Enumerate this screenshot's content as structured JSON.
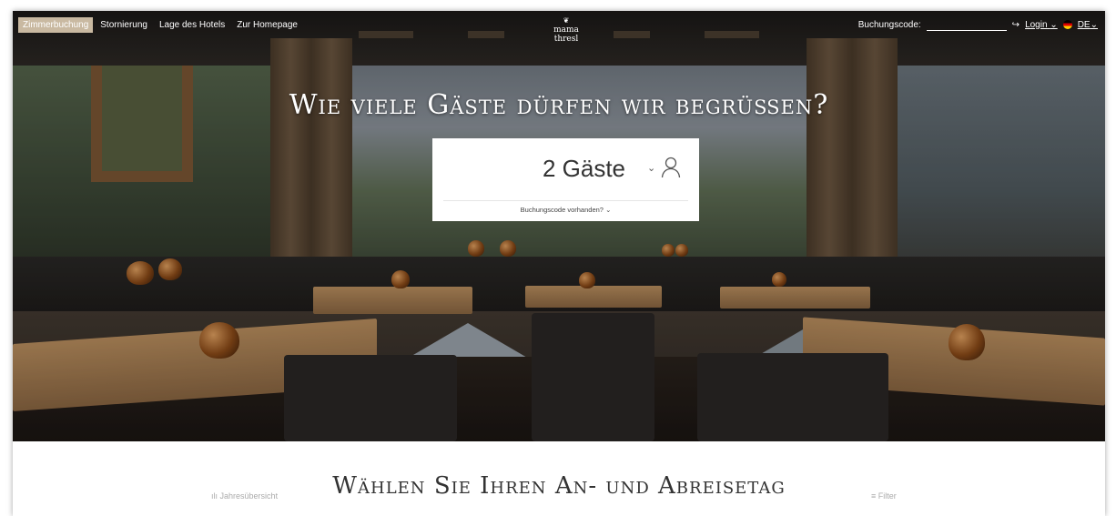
{
  "nav": {
    "links": [
      {
        "label": "Zimmerbuchung"
      },
      {
        "label": "Stornierung"
      },
      {
        "label": "Lage des Hotels"
      },
      {
        "label": "Zur Homepage"
      }
    ],
    "logo_line1": "mama",
    "logo_line2": "thresl",
    "booking_code_label": "Buchungscode:",
    "booking_code_value": "",
    "submit_icon": "↪",
    "login_label": "Login",
    "language_label": "DE"
  },
  "hero": {
    "title": "Wie viele Gäste dürfen wir begrüßen?"
  },
  "guest_selector": {
    "value": "2 Gäste",
    "chevron": "⌄",
    "booking_code_link": "Buchungscode vorhanden?"
  },
  "bottom": {
    "year_overview": "Jahresübersicht",
    "title": "Wählen Sie Ihren An- und Abreisetag",
    "filter": "Filter"
  },
  "colors": {
    "active_tab": "#c9b9a1",
    "text_dark": "#333333",
    "link_muted": "#aaaaaa"
  }
}
